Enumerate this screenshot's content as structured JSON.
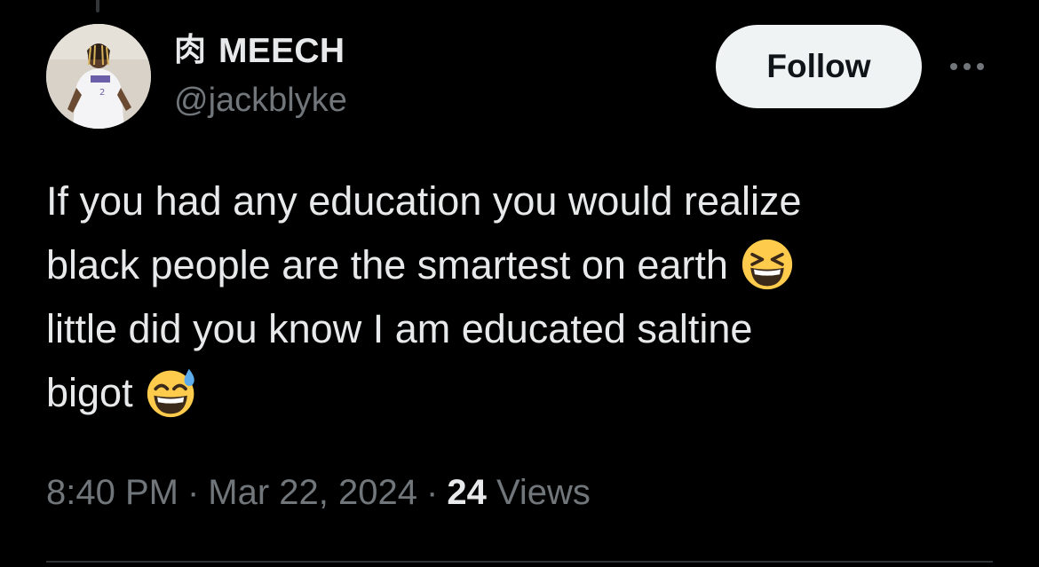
{
  "author": {
    "name_glyph": "肉",
    "display_name": "MEECH",
    "handle": "@jackblyke",
    "avatar_icon": "profile-photo-person-in-white-jersey"
  },
  "actions": {
    "follow_label": "Follow",
    "more_icon": "more-horizontal-icon"
  },
  "tweet": {
    "lines": [
      "If you had any education you would realize",
      "black people are the smartest on earth",
      "little did you know I am educated saltine",
      "bigot"
    ],
    "emojis": [
      {
        "name": "grinning-squinting-face-emoji",
        "after_line": 2
      },
      {
        "name": "grinning-face-with-sweat-emoji",
        "after_line": 4
      }
    ]
  },
  "meta": {
    "time": "8:40 PM",
    "separator": "·",
    "date": "Mar 22, 2024",
    "views_count": "24",
    "views_label": "Views"
  },
  "colors": {
    "background": "#000000",
    "primary_text": "#e7e9ea",
    "secondary_text": "#71767b",
    "follow_bg": "#eff3f4",
    "follow_text": "#0f1419",
    "emoji_yellow": "#ffcb4c",
    "sweat_blue": "#5dadec"
  }
}
